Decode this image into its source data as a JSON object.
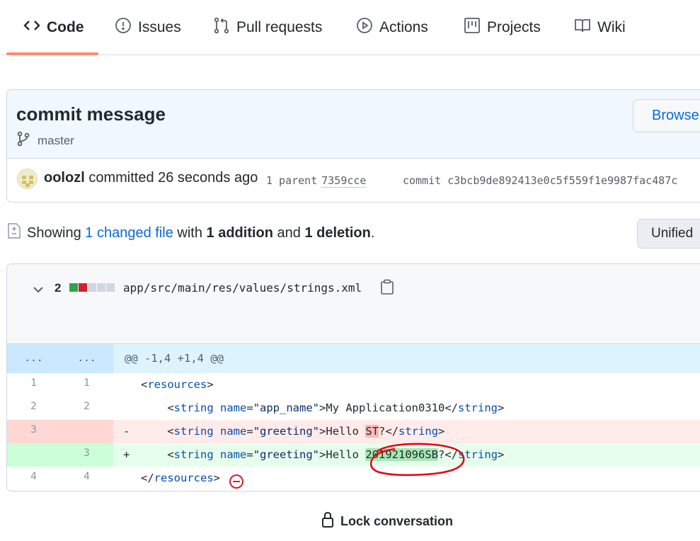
{
  "nav": {
    "tabs": [
      {
        "label": "Code",
        "icon": "code-icon",
        "active": true
      },
      {
        "label": "Issues",
        "icon": "issue-icon",
        "active": false
      },
      {
        "label": "Pull requests",
        "icon": "pull-request-icon",
        "active": false
      },
      {
        "label": "Actions",
        "icon": "play-icon",
        "active": false
      },
      {
        "label": "Projects",
        "icon": "project-icon",
        "active": false
      },
      {
        "label": "Wiki",
        "icon": "book-icon",
        "active": false
      }
    ],
    "active_color": "#fd8c73"
  },
  "commit": {
    "title": "commit message",
    "branch": "master",
    "browse_label": "Browse",
    "author": "oolozl",
    "action_text": "committed 26 seconds ago",
    "parent_label": "1 parent",
    "parent_sha": "7359cce",
    "commit_label": "commit",
    "commit_sha": "c3bcb9de892413e0c5f559f1e9987fac487c"
  },
  "toolbar": {
    "showing": "Showing",
    "changed_files": "1 changed file",
    "with": "with",
    "additions": "1 addition",
    "and": "and",
    "deletions": "1 deletion",
    "period": ".",
    "view_mode": "Unified"
  },
  "file": {
    "change_count": "2",
    "diffstat": [
      "added",
      "deleted",
      "neutral",
      "neutral",
      "neutral"
    ],
    "path": "app/src/main/res/values/strings.xml"
  },
  "hunk": {
    "left": "...",
    "right": "...",
    "header": "@@ -1,4 +1,4 @@"
  },
  "lines": [
    {
      "old": "1",
      "new": "1",
      "sign": " ",
      "open": "<",
      "tag": "resources",
      "close": ">"
    },
    {
      "old": "2",
      "new": "2",
      "sign": " ",
      "indent": "    ",
      "lt": "<",
      "tag": "string",
      "sp": " ",
      "attr": "name",
      "eq": "=",
      "val": "\"app_name\"",
      "gt": ">",
      "text": "My Application0310",
      "end_lt": "</",
      "end_tag": "string",
      "end_gt": ">"
    },
    {
      "old": "3",
      "new": "",
      "sign": "-",
      "indent": "    ",
      "lt": "<",
      "tag": "string",
      "sp": " ",
      "attr": "name",
      "eq": "=",
      "val": "\"greeting\"",
      "gt": ">",
      "text": "Hello ",
      "hl": "ST",
      "after": "?",
      "end_lt": "</",
      "end_tag": "string",
      "end_gt": ">"
    },
    {
      "old": "",
      "new": "3",
      "sign": "+",
      "indent": "    ",
      "lt": "<",
      "tag": "string",
      "sp": " ",
      "attr": "name",
      "eq": "=",
      "val": "\"greeting\"",
      "gt": ">",
      "text": "Hello ",
      "hl": "201921096SB",
      "after": "?",
      "end_lt": "</",
      "end_tag": "string",
      "end_gt": ">"
    },
    {
      "old": "4",
      "new": "4",
      "sign": " ",
      "open": "</",
      "tag": "resources",
      "close": ">"
    }
  ],
  "footer": {
    "lock_label": "Lock conversation"
  }
}
